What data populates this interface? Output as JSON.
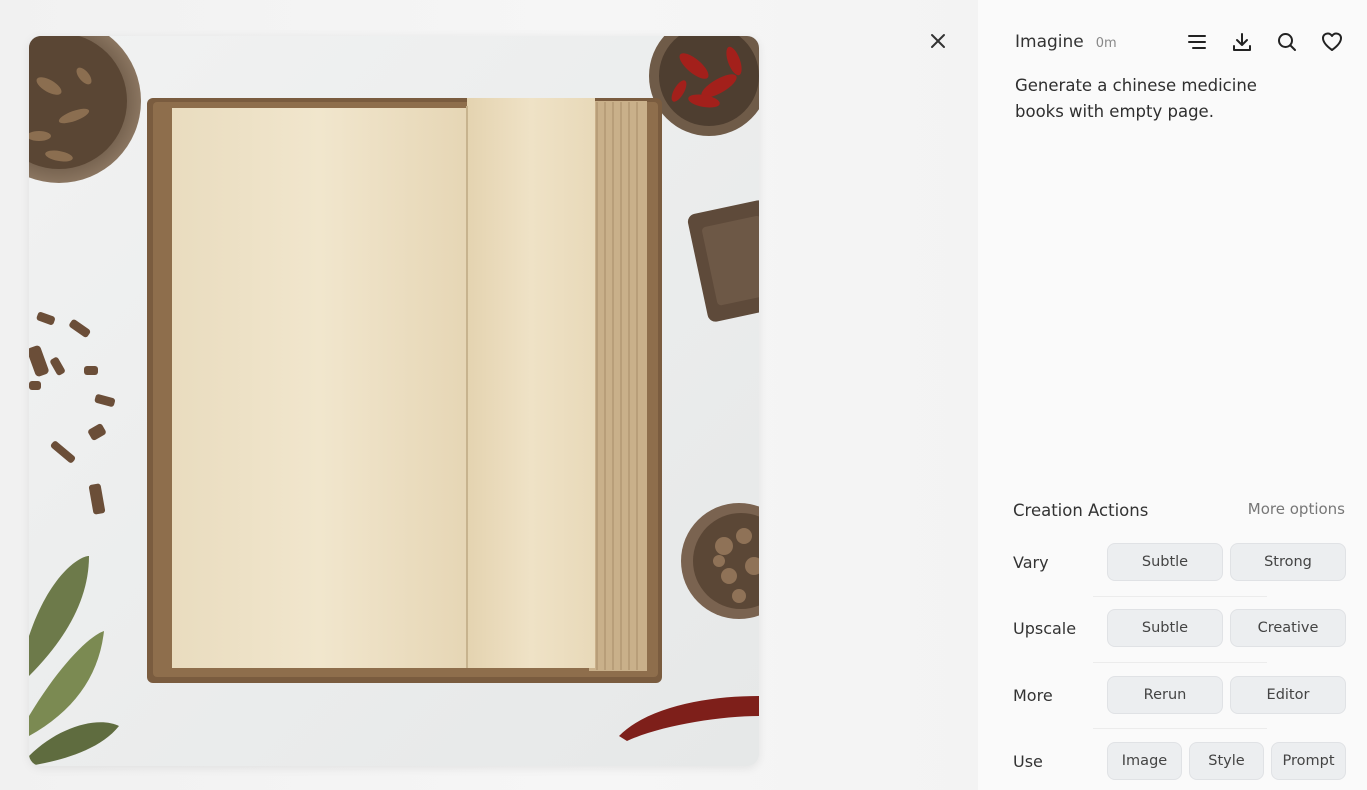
{
  "header": {
    "app_name": "Imagine",
    "age": "0m",
    "icons": [
      "menu-lines-icon",
      "download-icon",
      "search-icon",
      "heart-icon"
    ]
  },
  "close_icon": "close-icon",
  "prompt_text": "Generate a chinese medicine books with empty page.",
  "creation_actions": {
    "title": "Creation Actions",
    "more_options": "More options",
    "rows": [
      {
        "label": "Vary",
        "buttons": [
          "Subtle",
          "Strong"
        ]
      },
      {
        "label": "Upscale",
        "buttons": [
          "Subtle",
          "Creative"
        ]
      },
      {
        "label": "More",
        "buttons": [
          "Rerun",
          "Editor"
        ]
      },
      {
        "label": "Use",
        "buttons": [
          "Image",
          "Style",
          "Prompt"
        ]
      }
    ]
  },
  "colors": {
    "panel_bg": "#fafafa",
    "button_bg": "#eceef0",
    "page_paper": "#efe2c6",
    "book_cover": "#8a6a4a"
  }
}
